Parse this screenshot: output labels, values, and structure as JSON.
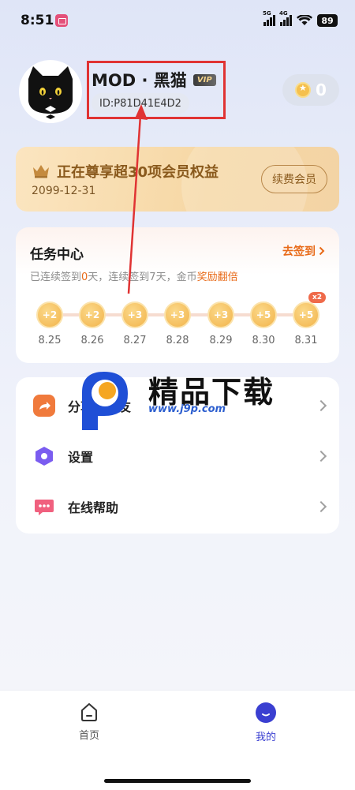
{
  "status_bar": {
    "time": "8:51",
    "signal_label_1": "5G",
    "signal_label_2": "4G",
    "battery": "89"
  },
  "profile": {
    "nickname": "MOD · 黑猫",
    "vip_label": "VIP",
    "user_id": "ID:P81D41E4D2",
    "coins": "0"
  },
  "member_card": {
    "title": "正在尊享超30项会员权益",
    "expiry": "2099-12-31",
    "renew_label": "续费会员"
  },
  "tasks": {
    "title": "任务中心",
    "checkin_label": "去签到",
    "summary_prefix": "已连续签到",
    "summary_days": "0",
    "summary_middle": "天，连续签到7天，金币",
    "summary_highlight": "奖励翻倍",
    "days": [
      {
        "reward": "+2",
        "date": "8.25"
      },
      {
        "reward": "+2",
        "date": "8.26"
      },
      {
        "reward": "+3",
        "date": "8.27"
      },
      {
        "reward": "+3",
        "date": "8.28"
      },
      {
        "reward": "+3",
        "date": "8.29"
      },
      {
        "reward": "+5",
        "date": "8.30"
      },
      {
        "reward": "+5",
        "date": "8.31"
      }
    ],
    "bonus_badge": "x2"
  },
  "menu": {
    "items": [
      {
        "label": "分享给好友",
        "icon": "share-icon",
        "color": "#f07a3c"
      },
      {
        "label": "设置",
        "icon": "settings-hexagon-icon",
        "color": "#7a5cf0"
      },
      {
        "label": "在线帮助",
        "icon": "help-chat-icon",
        "color": "#f0607e"
      }
    ]
  },
  "watermark": {
    "title": "精品下载",
    "url": "www.j9p.com"
  },
  "bottom_nav": {
    "tabs": [
      {
        "label": "首页",
        "icon": "home-icon",
        "active": false
      },
      {
        "label": "我的",
        "icon": "profile-icon",
        "active": true
      }
    ]
  },
  "colors": {
    "accent": "#3a3fd1",
    "orange": "#e86a18",
    "annotation_red": "#e03333",
    "gold": "#f2b34a"
  }
}
